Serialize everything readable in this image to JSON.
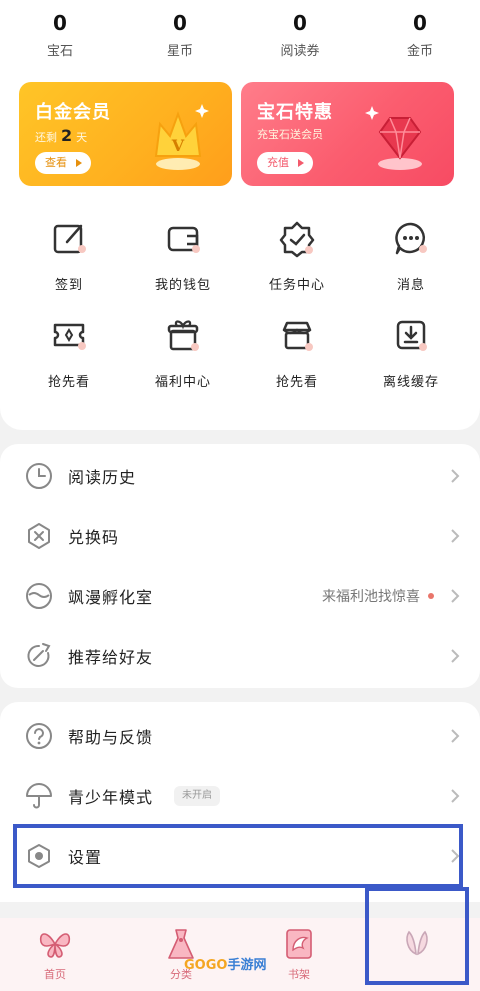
{
  "stats": [
    {
      "value": "0",
      "label": "宝石"
    },
    {
      "value": "0",
      "label": "星币"
    },
    {
      "value": "0",
      "label": "阅读券"
    },
    {
      "value": "0",
      "label": "金币"
    }
  ],
  "promos": {
    "vip": {
      "title": "白金会员",
      "sub_prefix": "还剩",
      "sub_value": "2",
      "sub_suffix": "天",
      "button": "查看"
    },
    "gem": {
      "title": "宝石特惠",
      "sub": "充宝石送会员",
      "button": "充值"
    }
  },
  "grid": [
    {
      "label": "签到",
      "icon": "edit-icon"
    },
    {
      "label": "我的钱包",
      "icon": "wallet-icon"
    },
    {
      "label": "任务中心",
      "icon": "task-badge-icon"
    },
    {
      "label": "消息",
      "icon": "message-icon"
    },
    {
      "label": "抢先看",
      "icon": "ticket-icon"
    },
    {
      "label": "福利中心",
      "icon": "gift-icon"
    },
    {
      "label": "抢先看",
      "icon": "store-icon"
    },
    {
      "label": "离线缓存",
      "icon": "download-icon"
    }
  ],
  "list_a": [
    {
      "label": "阅读历史",
      "icon": "clock-icon"
    },
    {
      "label": "兑换码",
      "icon": "redeem-icon"
    },
    {
      "label": "飒漫孵化室",
      "icon": "incubator-icon",
      "extra": "来福利池找惊喜"
    },
    {
      "label": "推荐给好友",
      "icon": "share-icon"
    }
  ],
  "list_b": [
    {
      "label": "帮助与反馈",
      "icon": "help-icon"
    },
    {
      "label": "青少年模式",
      "icon": "umbrella-icon",
      "badge": "未开启"
    },
    {
      "label": "设置",
      "icon": "settings-icon"
    }
  ],
  "tabs": [
    {
      "label": "首页",
      "icon": "butterfly-icon"
    },
    {
      "label": "分类",
      "icon": "dress-icon"
    },
    {
      "label": "书架",
      "icon": "book-wing-icon"
    },
    {
      "label": "",
      "icon": "wings-icon"
    }
  ],
  "watermark": {
    "brand": "GOGO",
    "suffix": "手游网"
  },
  "colors": {
    "vip": "#ffb01f",
    "gem": "#f74b63",
    "accent": "#e9756a",
    "highlight": "#3b59c8"
  }
}
